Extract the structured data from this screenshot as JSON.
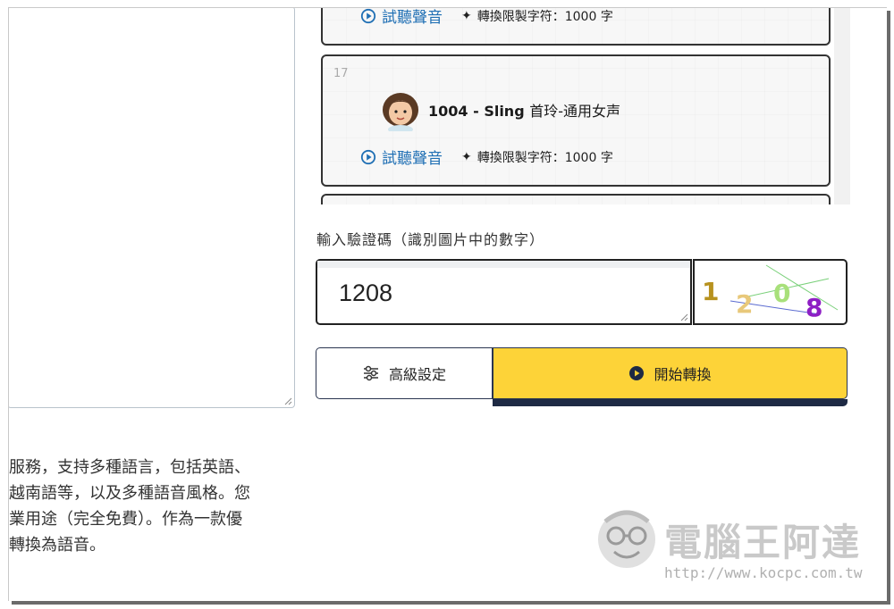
{
  "voices": [
    {
      "index": "",
      "listen_label": "試聽聲音",
      "limit_label": "轉換限製字符：1000 字"
    },
    {
      "index": "17",
      "id_name": "1004 - Sling",
      "cn_name": "首玲-通用女声",
      "listen_label": "試聽聲音",
      "limit_label": "轉換限製字符：1000 字"
    }
  ],
  "captcha": {
    "label": "輸入驗證碼（識別圖片中的數字）",
    "value": "1208",
    "image_digits": [
      "1",
      "2",
      "0",
      "8"
    ]
  },
  "buttons": {
    "advanced": "高級設定",
    "start": "開始轉換"
  },
  "left_text": {
    "lines": [
      "服務，支持多種語言，包括英語、",
      " 越南語等，以及多種語音風格。您",
      "業用途（完全免費）。作為一款優",
      "轉換為語音。"
    ]
  },
  "watermark": {
    "title": "電腦王阿達",
    "url": "http://www.kocpc.com.tw"
  },
  "colors": {
    "accent_yellow": "#fdd338",
    "link_blue": "#1f6fb4",
    "dark_navy": "#1e2a44"
  }
}
